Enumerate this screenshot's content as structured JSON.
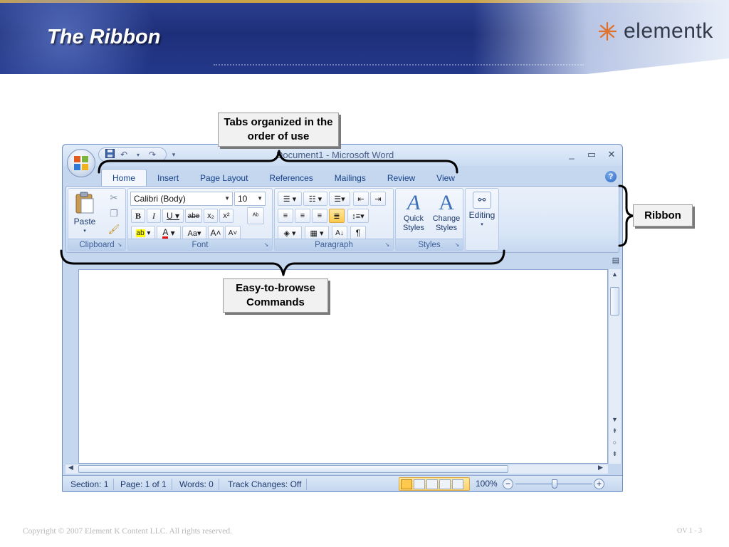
{
  "slide": {
    "title": "The Ribbon",
    "brand": "elementk",
    "footer": "Copyright © 2007 Element K Content LLC. All rights reserved.",
    "slide_number": "OV 1 - 3"
  },
  "callouts": {
    "tabs": "Tabs organized in the order of use",
    "ribbon": "Ribbon",
    "commands": "Easy-to-browse Commands"
  },
  "window": {
    "title": "Document1 - Microsoft Word",
    "controls": [
      "_",
      "▭",
      "✕"
    ],
    "tabs": [
      "Home",
      "Insert",
      "Page Layout",
      "References",
      "Mailings",
      "Review",
      "View"
    ],
    "active_tab": "Home",
    "help": "?"
  },
  "ribbon": {
    "clipboard": {
      "label": "Clipboard",
      "paste_label": "Paste"
    },
    "font": {
      "label": "Font",
      "font_name": "Calibri (Body)",
      "font_size": "10"
    },
    "paragraph": {
      "label": "Paragraph"
    },
    "styles": {
      "label": "Styles",
      "quick": "Quick Styles",
      "change": "Change Styles"
    },
    "editing": {
      "label": "Editing"
    }
  },
  "statusbar": {
    "section": "Section: 1",
    "page": "Page: 1 of 1",
    "words": "Words: 0",
    "track_changes": "Track Changes: Off",
    "zoom": "100%",
    "zoom_minus": "−",
    "zoom_plus": "+"
  },
  "colors": {
    "header_blue": "#1e2f7a",
    "brand_accent": "#e0702a",
    "ribbon_bg": "#d9e6f7",
    "tab_text": "#15428b"
  },
  "icons": [
    "office-button-icon",
    "save-icon",
    "undo-icon",
    "redo-icon",
    "help-icon",
    "paste-icon",
    "cut-icon",
    "copy-icon",
    "format-painter-icon",
    "bold-icon",
    "italic-icon",
    "underline-icon",
    "binoculars-icon"
  ]
}
